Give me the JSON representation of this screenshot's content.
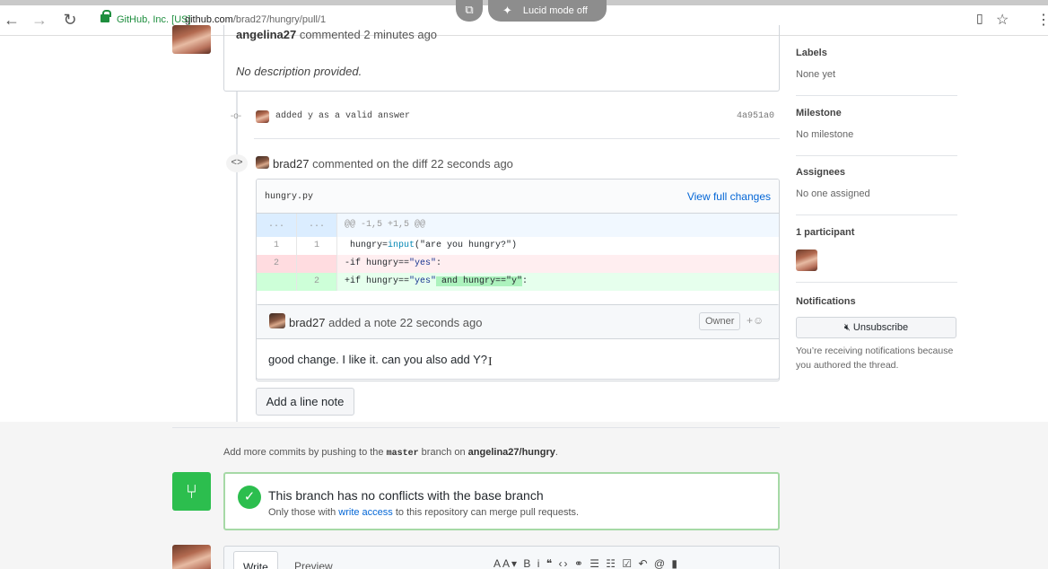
{
  "browser": {
    "security_label": "GitHub, Inc. [US]",
    "url_host": "github.com",
    "url_path": "/brad27/hungry/pull/1",
    "lucid_label": "Lucid mode off"
  },
  "top_comment": {
    "author": "angelina27",
    "action": "commented 2 minutes ago",
    "body": "No description provided."
  },
  "commit": {
    "message": "added y as a valid answer",
    "sha": "4a951a0"
  },
  "review": {
    "author": "brad27",
    "action": "commented on the diff 22 seconds ago",
    "file_name": "hungry.py",
    "view_full_label": "View full changes",
    "hunk_left": "...",
    "hunk_right": "...",
    "hunk_header": "@@ -1,5 +1,5 @@",
    "line1": {
      "old": "1",
      "new": "1",
      "var": " hungry=",
      "fn": "input",
      "rest": "(\"are you hungry?\")"
    },
    "line2": {
      "old": "2",
      "new": "",
      "prefix": "-if hungry==",
      "str": "\"yes\"",
      "rest": ":"
    },
    "line3": {
      "old": "",
      "new": "2",
      "prefix": "+if hungry==",
      "str": "\"yes\"",
      "hl": " and hungry==\"y\"",
      "rest": ":"
    }
  },
  "note": {
    "author": "brad27",
    "action": "added a note 22 seconds ago",
    "badge": "Owner",
    "reaction": "+☺",
    "body": "good change. I like it. can you also add Y?"
  },
  "add_line_note_label": "Add a line note",
  "push_info": {
    "prefix": "Add more commits by pushing to the",
    "branch": "master",
    "middle": "branch on",
    "repo": "angelina27/hungry",
    "suffix": "."
  },
  "merge_status": {
    "title": "This branch has no conflicts with the base branch",
    "sub_prefix": "Only those with",
    "sub_link": "write access",
    "sub_suffix": "to this repository can merge pull requests."
  },
  "editor": {
    "write_tab": "Write",
    "preview_tab": "Preview",
    "toolbar": "AA▾ B i   ❝ ‹› ⚭   ☰ ☷ ☑   ↶ @ ▮"
  },
  "sidebar": {
    "labels_title": "Labels",
    "labels_value": "None yet",
    "milestone_title": "Milestone",
    "milestone_value": "No milestone",
    "assignees_title": "Assignees",
    "assignees_value": "No one assigned",
    "participants_title": "1 participant",
    "notifications_title": "Notifications",
    "unsubscribe_label": "Unsubscribe",
    "notifications_note": "You’re receiving notifications because you authored the thread."
  }
}
